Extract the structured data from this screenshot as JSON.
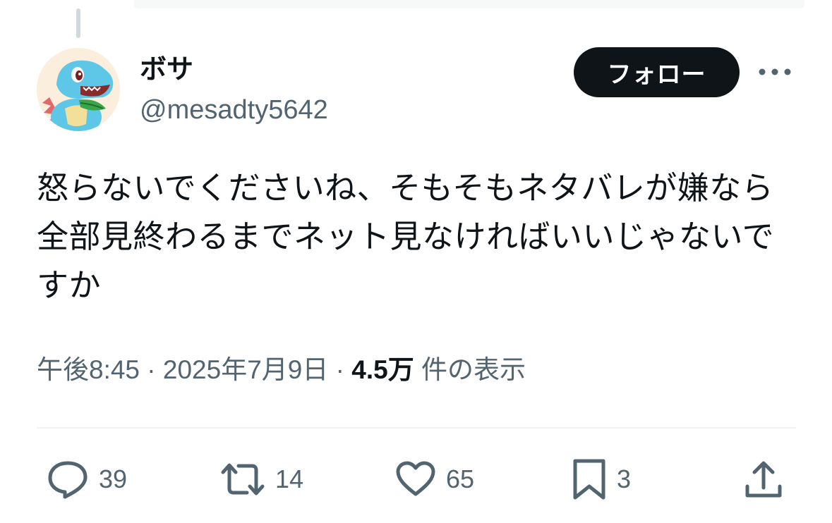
{
  "tweet": {
    "author": {
      "display_name": "ボサ",
      "handle": "@mesadty5642"
    },
    "follow_label": "フォロー",
    "text": "怒らないでくださいね、そもそもネタバレが嫌なら全部見終わるまでネット見なければいいじゃないですか",
    "time": "午後8:45",
    "separator": "·",
    "date": "2025年7月9日",
    "views_count": "4.5万",
    "views_label": "件の表示",
    "actions": {
      "replies": "39",
      "retweets": "14",
      "likes": "65",
      "bookmarks": "3"
    }
  },
  "colors": {
    "text_primary": "#0f1419",
    "text_secondary": "#536471",
    "follow_bg": "#0f1419",
    "divider": "#eff3f4"
  },
  "icons": [
    "more-icon",
    "reply-icon",
    "retweet-icon",
    "like-icon",
    "bookmark-icon",
    "share-icon"
  ]
}
